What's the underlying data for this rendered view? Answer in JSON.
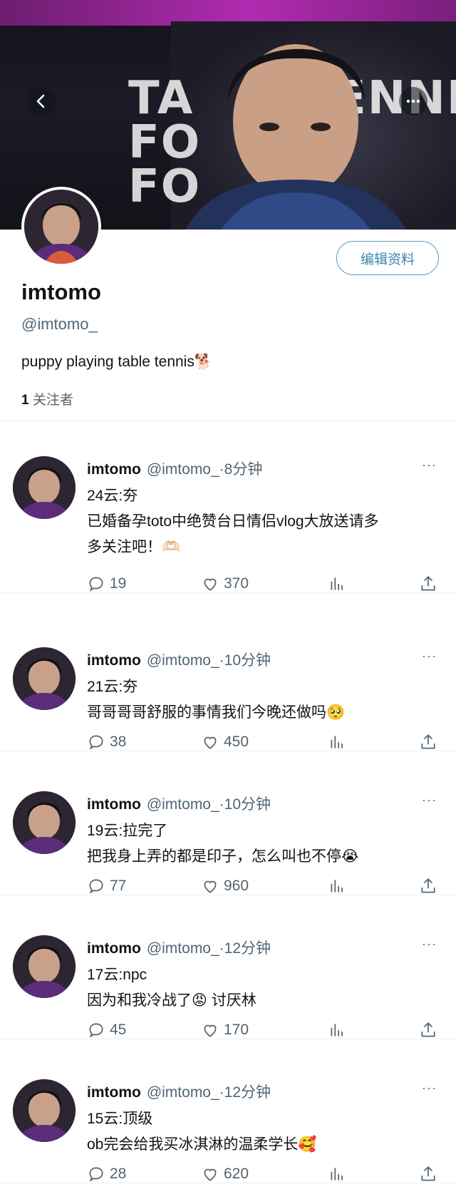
{
  "header": {
    "banner_text": [
      "TA",
      "FO",
      "FO",
      "ENNI"
    ],
    "back_icon": "back-arrow-icon",
    "more_icon": "more-horizontal-icon"
  },
  "profile": {
    "display_name": "imtomo",
    "handle": "@imtomo_",
    "bio": "puppy playing table tennis🐕",
    "followers_count": "1",
    "followers_label": "关注者",
    "edit_button": "编辑资料"
  },
  "tweets": [
    {
      "name": "imtomo",
      "meta": "@imtomo_·8分钟",
      "lines": [
        "24云:夯",
        "已婚备孕toto中绝赞台日情侣vlog大放送请多",
        "多关注吧！🫶🏻"
      ],
      "replies": "19",
      "likes": "370"
    },
    {
      "name": "imtomo",
      "meta": "@imtomo_·10分钟",
      "lines": [
        "21云:夯",
        "哥哥哥哥舒服的事情我们今晚还做吗🥺"
      ],
      "replies": "38",
      "likes": "450"
    },
    {
      "name": "imtomo",
      "meta": "@imtomo_·10分钟",
      "lines": [
        "19云:拉完了",
        "把我身上弄的都是印子，怎么叫也不停😭"
      ],
      "replies": "77",
      "likes": "960"
    },
    {
      "name": "imtomo",
      "meta": "@imtomo_·12分钟",
      "lines": [
        "17云:npc",
        "因为和我冷战了😡 讨厌林"
      ],
      "replies": "45",
      "likes": "170"
    },
    {
      "name": "imtomo",
      "meta": "@imtomo_·12分钟",
      "lines": [
        "15云:顶级",
        "ob完会给我买冰淇淋的温柔学长🥰"
      ],
      "replies": "28",
      "likes": "620"
    }
  ],
  "colors": {
    "accent_border": "#5d9bbf",
    "muted_text": "#536471",
    "text": "#0f1419",
    "banner_stripe": "#b02bb0"
  }
}
